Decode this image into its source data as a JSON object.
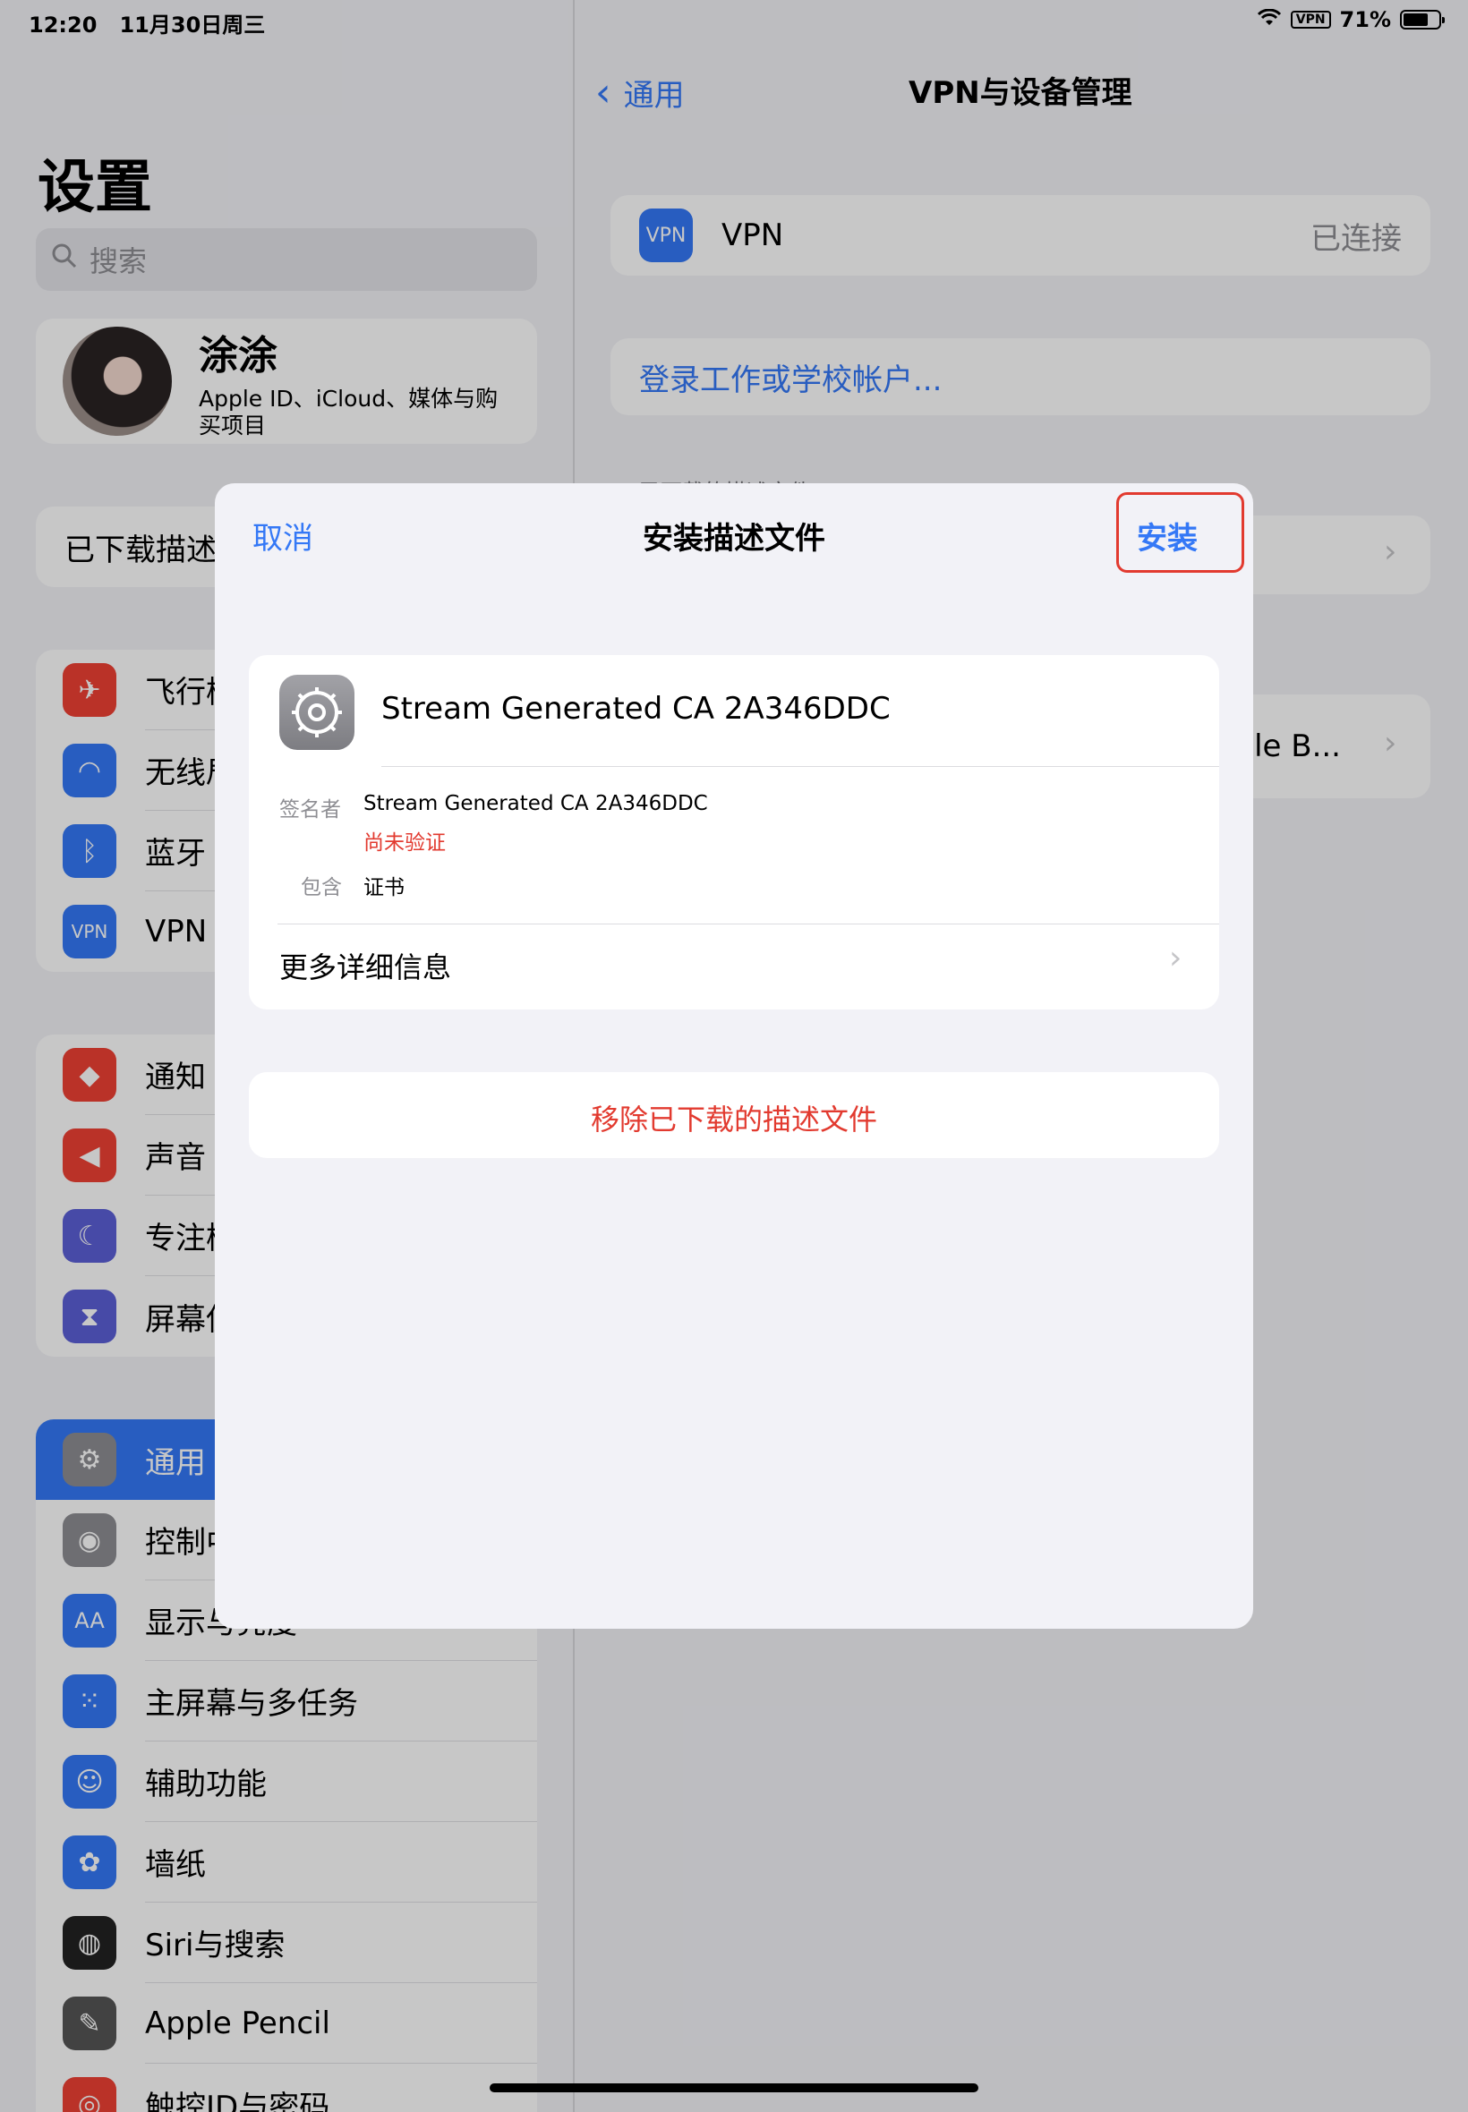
{
  "status_bar": {
    "time": "12:20",
    "date": "11月30日周三",
    "vpn": "VPN",
    "battery": "71%",
    "battery_level": 0.71
  },
  "sidebar": {
    "title": "设置",
    "search_placeholder": "搜索",
    "profile": {
      "name": "涂涂",
      "subtitle": "Apple ID、iCloud、媒体与购买项目"
    },
    "downloaded": "已下载描述",
    "group1": [
      {
        "label": "飞行模式",
        "icon": "airplane-icon",
        "color": "#ef4034"
      },
      {
        "label": "无线局域网",
        "icon": "wifi-icon",
        "color": "#3478f6"
      },
      {
        "label": "蓝牙",
        "icon": "bluetooth-icon",
        "color": "#3478f6"
      },
      {
        "label": "VPN",
        "icon": "vpn-icon",
        "color": "#3478f6"
      }
    ],
    "group2": [
      {
        "label": "通知",
        "icon": "bell-icon",
        "color": "#ef4034"
      },
      {
        "label": "声音",
        "icon": "speaker-icon",
        "color": "#ef4034"
      },
      {
        "label": "专注模式",
        "icon": "moon-icon",
        "color": "#5b5fd6"
      },
      {
        "label": "屏幕使用时间",
        "icon": "hourglass-icon",
        "color": "#5b5fd6"
      }
    ],
    "group3": [
      {
        "label": "通用",
        "icon": "gear-icon",
        "color": "#8e8e93"
      },
      {
        "label": "控制中心",
        "icon": "toggle-icon",
        "color": "#8e8e93"
      },
      {
        "label": "显示与亮度",
        "icon": "text-size-icon",
        "color": "#3478f6"
      },
      {
        "label": "主屏幕与多任务",
        "icon": "grid-icon",
        "color": "#3478f6"
      },
      {
        "label": "辅助功能",
        "icon": "accessibility-icon",
        "color": "#3478f6"
      },
      {
        "label": "墙纸",
        "icon": "flower-icon",
        "color": "#3478f6"
      },
      {
        "label": "Siri与搜索",
        "icon": "siri-icon",
        "color": "#222222"
      },
      {
        "label": "Apple Pencil",
        "icon": "pencil-icon",
        "color": "#555555"
      },
      {
        "label": "触控ID与密码",
        "icon": "fingerprint-icon",
        "color": "#ef4034"
      }
    ]
  },
  "detail": {
    "back": "通用",
    "title": "VPN与设备管理",
    "vpn_icon_text": "VPN",
    "vpn_label": "VPN",
    "vpn_status": "已连接",
    "login": "登录工作或学校帐户...",
    "downloaded_header": "已下载的描述文件",
    "profile_partial": "file B..."
  },
  "modal": {
    "cancel": "取消",
    "title": "安装描述文件",
    "install": "安装",
    "profile_name": "Stream Generated CA 2A346DDC",
    "signer_key": "签名者",
    "signer_value": "Stream Generated CA 2A346DDC",
    "unverified": "尚未验证",
    "contains_key": "包含",
    "contains_value": "证书",
    "more_details": "更多详细信息",
    "remove": "移除已下载的描述文件"
  }
}
